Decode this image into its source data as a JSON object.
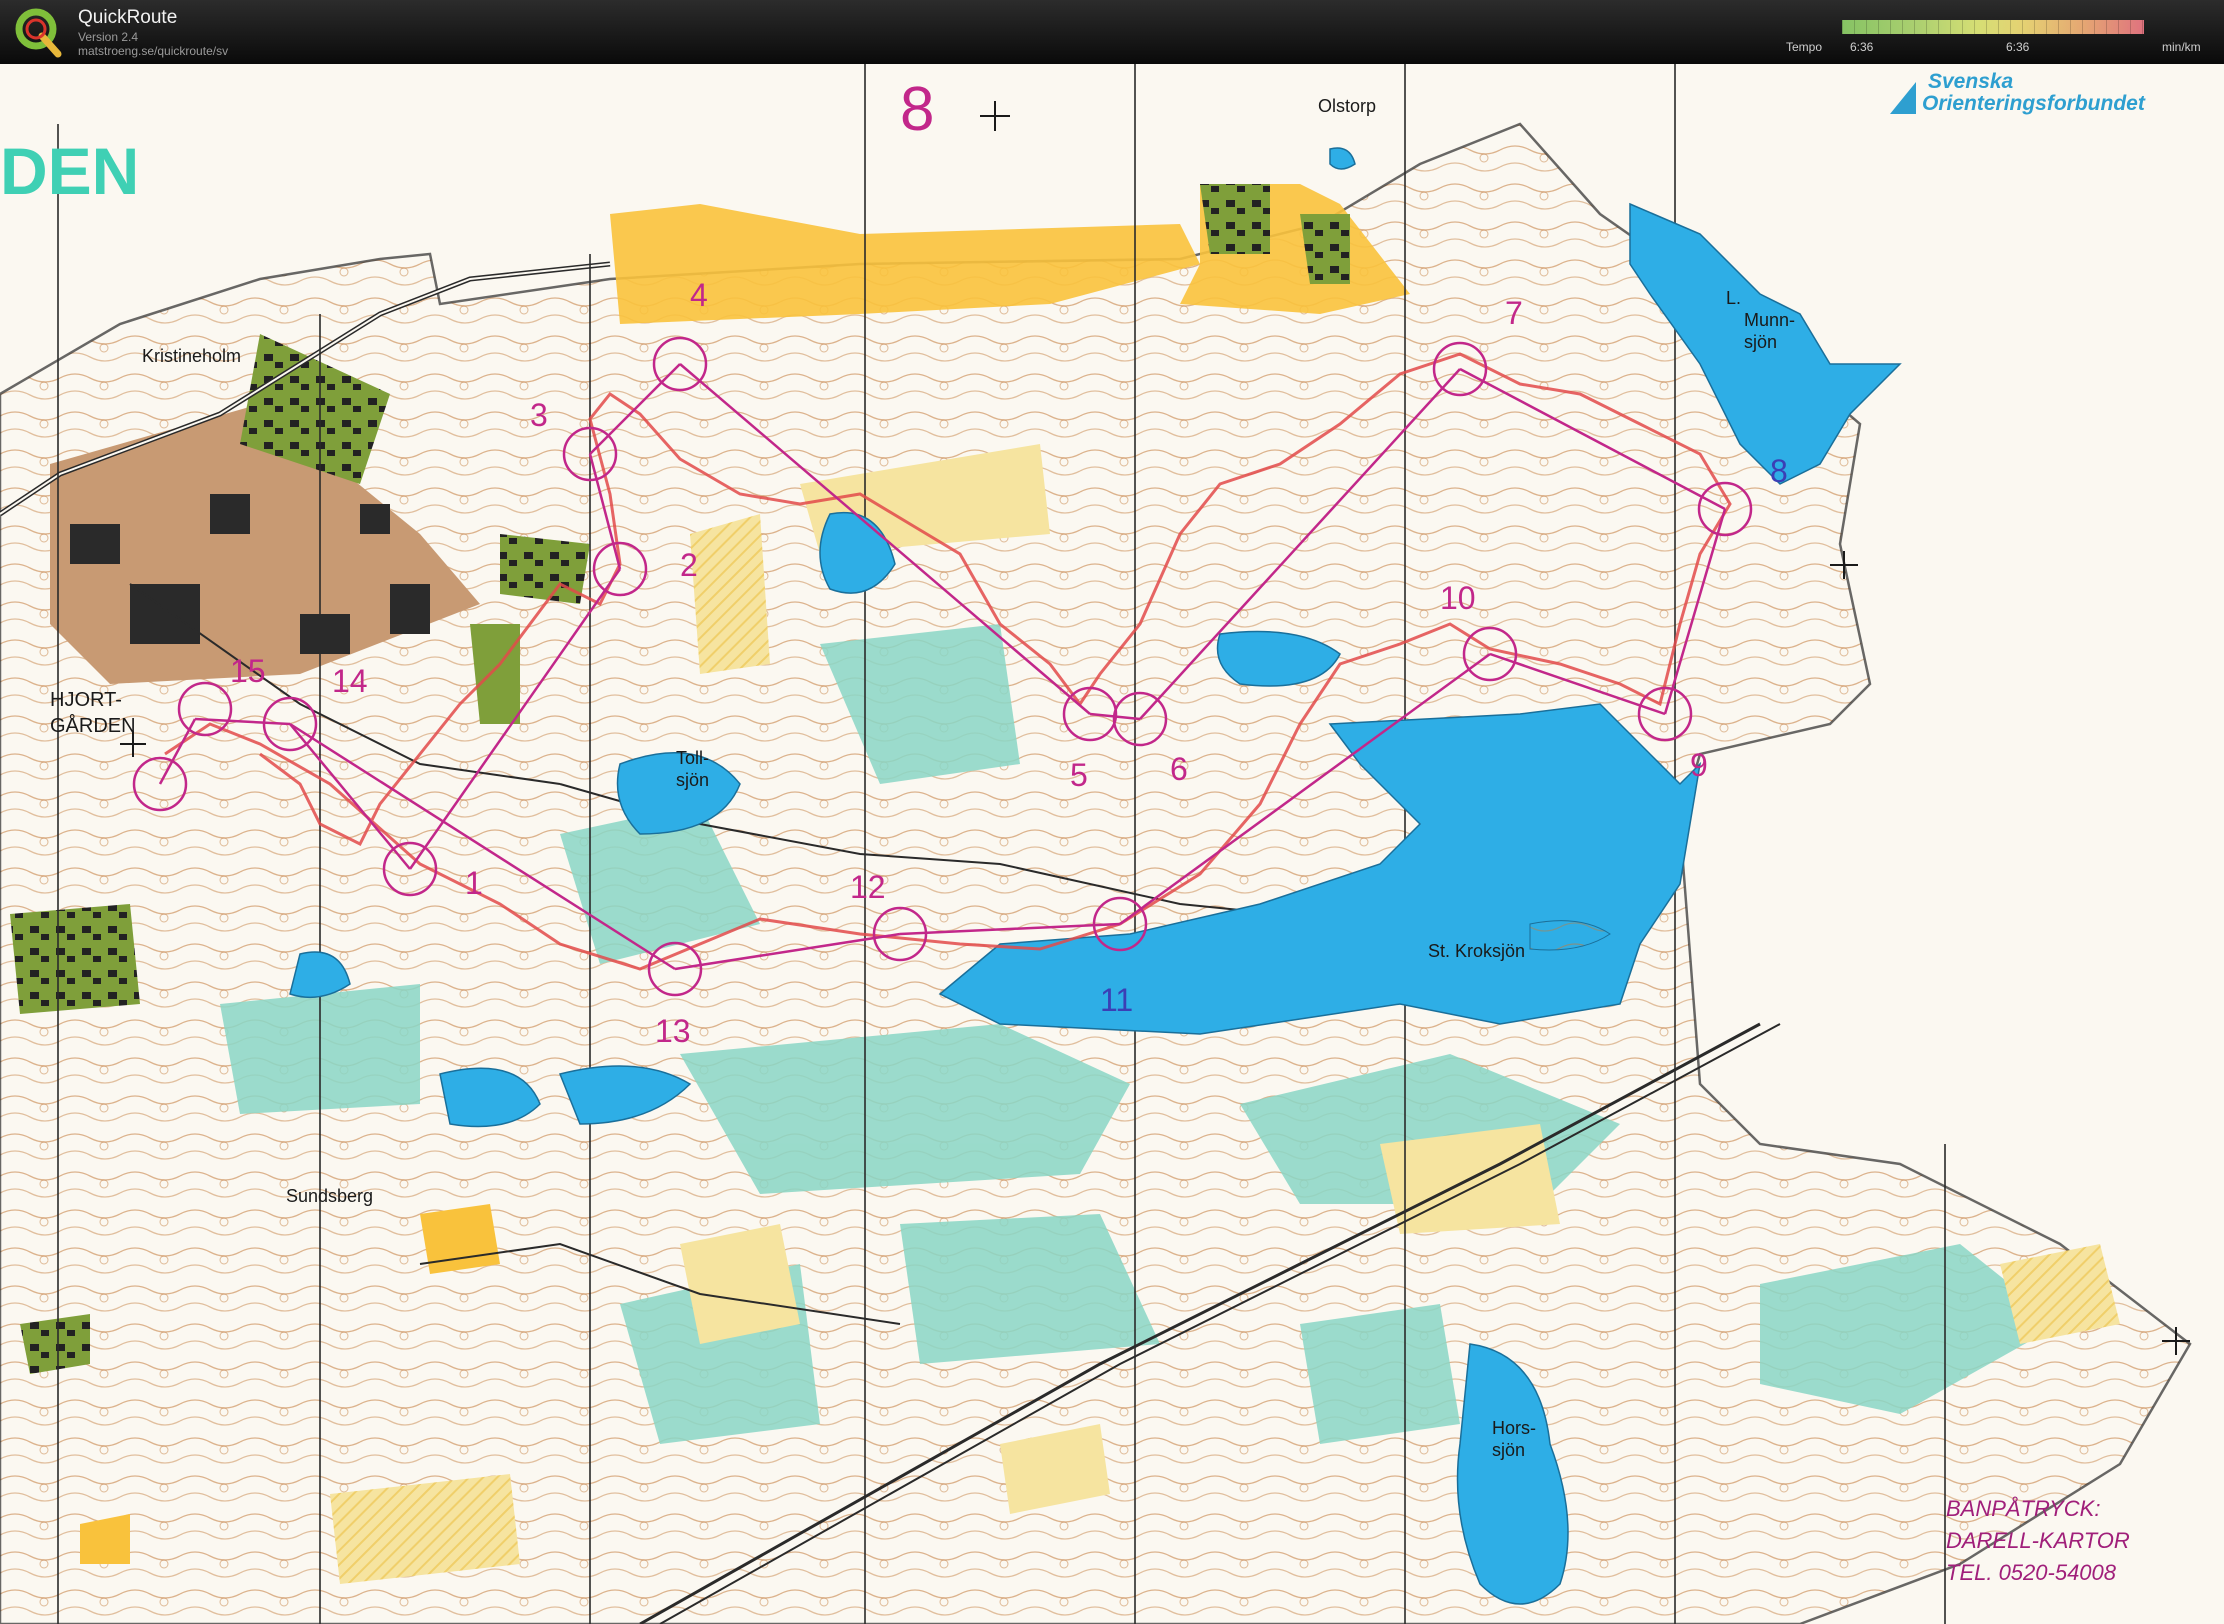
{
  "app": {
    "title": "QuickRoute",
    "version": "Version 2.4",
    "url": "matstroeng.se/quickroute/sv"
  },
  "tempo": {
    "label": "Tempo",
    "min_value": "6:36",
    "mid_value": "6:36",
    "unit": "min/km"
  },
  "map": {
    "organization": [
      "Svenska",
      "Orienteringsforbundet"
    ],
    "title_fragment": "DEN",
    "handwritten_number": "8",
    "print_note": [
      "BANPÅTRYCK:",
      "DARELL-KARTOR",
      "TEL. 0520-54008"
    ],
    "place_names": {
      "kristineholm": "Kristineholm",
      "olstorp": "Olstorp",
      "hjort": "HJORT-",
      "garden": "GÅRDEN",
      "toll": "Toll-",
      "toll_sjon": "sjön",
      "munn_l": "L.",
      "munn": "Munn-",
      "munn_sjon": "sjön",
      "kroksjon": "St. Kroksjön",
      "sundsberg": "Sundsberg",
      "hors": "Hors-",
      "hors_sjon": "sjön"
    },
    "controls": [
      "1",
      "2",
      "3",
      "4",
      "5",
      "6",
      "7",
      "8",
      "9",
      "10",
      "11",
      "12",
      "13",
      "14",
      "15"
    ],
    "colors": {
      "water": "#2eaee6",
      "open_land": "#f9c23c",
      "rough_open": "#f6e4a0",
      "green": "#8ad6c5",
      "course": "#c2278a",
      "route": "#e24a4a",
      "contour": "#b86a2a",
      "settlement": "#c89a73",
      "building": "#2a2a2a",
      "cultivated": "#7f9f3a"
    }
  }
}
